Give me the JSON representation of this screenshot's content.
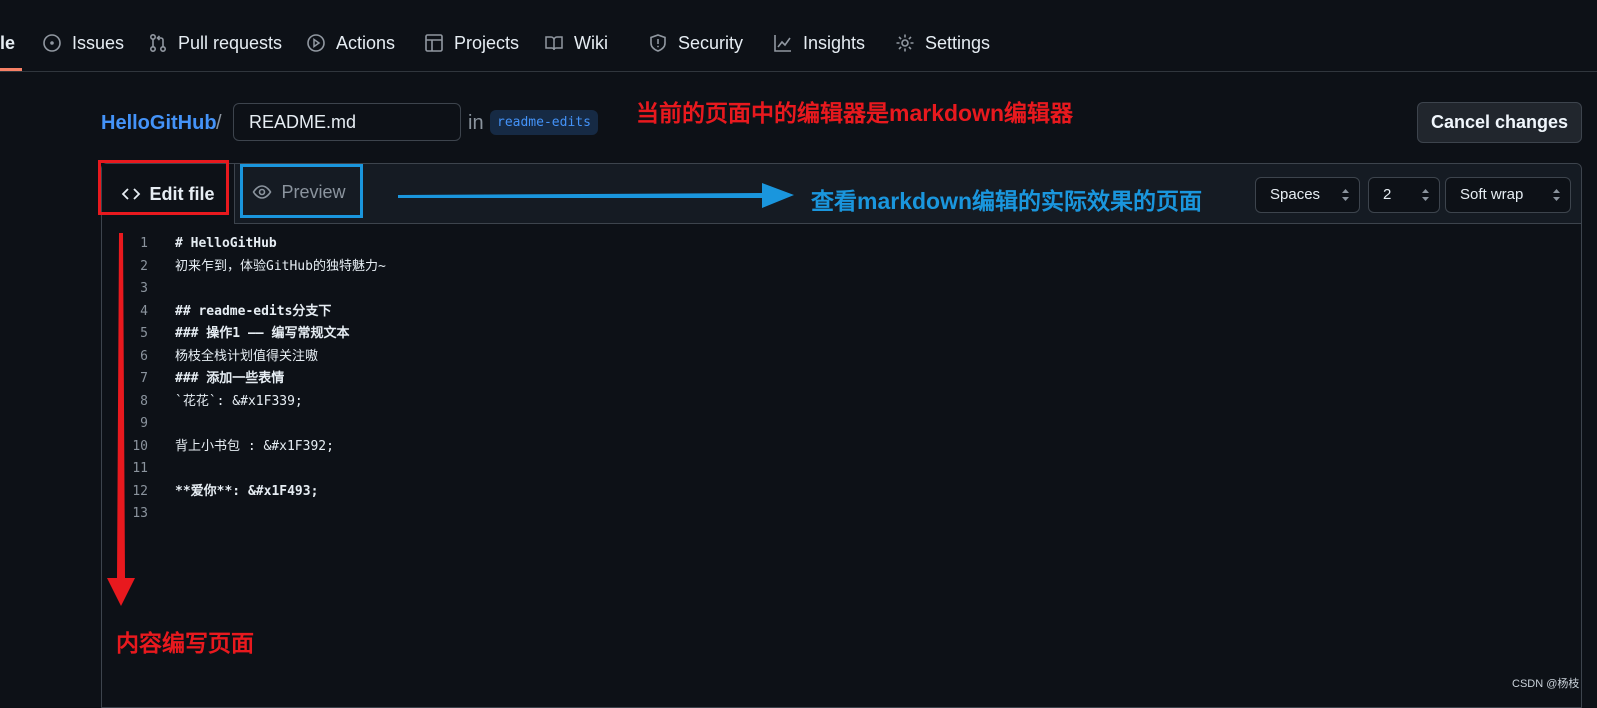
{
  "nav": {
    "partial_label": "le",
    "items": [
      {
        "label": "Issues",
        "icon": "issue-circle-icon"
      },
      {
        "label": "Pull requests",
        "icon": "pull-request-icon"
      },
      {
        "label": "Actions",
        "icon": "play-circle-icon"
      },
      {
        "label": "Projects",
        "icon": "table-icon"
      },
      {
        "label": "Wiki",
        "icon": "book-icon"
      },
      {
        "label": "Security",
        "icon": "shield-icon"
      },
      {
        "label": "Insights",
        "icon": "graph-icon"
      },
      {
        "label": "Settings",
        "icon": "gear-icon"
      }
    ]
  },
  "breadcrumb": {
    "repo": "HelloGitHub",
    "separator": "/",
    "filename": "README.md",
    "in_label": "in",
    "branch": "readme-edits"
  },
  "cancel_label": "Cancel changes",
  "editor": {
    "tab_edit": "Edit file",
    "tab_preview": "Preview",
    "indent_mode": "Spaces",
    "indent_size": "2",
    "wrap_mode": "Soft wrap",
    "lines": [
      {
        "n": "1",
        "text": "# HelloGitHub",
        "bold": true
      },
      {
        "n": "2",
        "text": "初来乍到，体验GitHub的独特魅力~",
        "bold": false
      },
      {
        "n": "3",
        "text": "",
        "bold": false
      },
      {
        "n": "4",
        "text": "## readme-edits分支下",
        "bold": true
      },
      {
        "n": "5",
        "text": "### 操作1 —— 编写常规文本",
        "bold": true
      },
      {
        "n": "6",
        "text": "杨枝全栈计划值得关注嗷",
        "bold": false
      },
      {
        "n": "7",
        "text": "### 添加一些表情",
        "bold": true
      },
      {
        "n": "8",
        "text": "`花花`: &#x1F339;",
        "bold": false
      },
      {
        "n": "9",
        "text": "",
        "bold": false
      },
      {
        "n": "10",
        "text": "背上小书包 : &#x1F392;",
        "bold": false
      },
      {
        "n": "11",
        "text": "",
        "bold": false
      },
      {
        "n": "12",
        "text": "**爱你**:  &#x1F493;",
        "bold": true
      },
      {
        "n": "13",
        "text": "",
        "bold": false
      }
    ]
  },
  "annotations": {
    "top": "当前的页面中的编辑器是markdown编辑器",
    "preview": "查看markdown编辑的实际效果的页面",
    "content": "内容编写页面"
  },
  "watermark": "CSDN @杨枝",
  "colors": {
    "accent": "#4493f8",
    "annotation_red": "#e8191e",
    "annotation_blue": "#1a96dd",
    "nav_underline": "#f78166"
  }
}
